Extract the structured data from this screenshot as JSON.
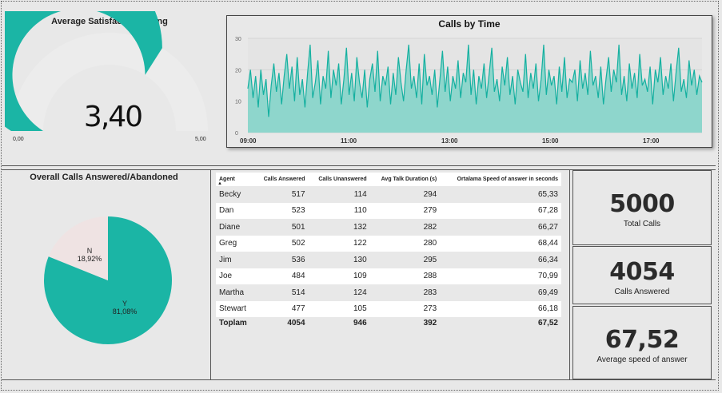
{
  "satisfaction": {
    "title": "Average Satisfaction Rating",
    "value_label": "3,40",
    "value": 3.4,
    "min_label": "0,00",
    "max_label": "5,00",
    "min": 0,
    "max": 5,
    "fill_color": "#1bb5a5",
    "track_color": "#ececec"
  },
  "chart_data": {
    "type": "area",
    "title": "Calls by Time",
    "xlabel": "",
    "ylabel": "",
    "ylim": [
      0,
      30
    ],
    "yticks": [
      "0",
      "10",
      "20",
      "30"
    ],
    "xticks": [
      "09:00",
      "11:00",
      "13:00",
      "15:00",
      "17:00"
    ],
    "grid": true,
    "line_color": "#14b0a0",
    "fill_color": "#8ed6cc",
    "values": [
      14,
      20,
      11,
      18,
      8,
      20,
      12,
      17,
      5,
      15,
      22,
      13,
      19,
      9,
      18,
      25,
      14,
      21,
      10,
      24,
      12,
      17,
      8,
      19,
      28,
      11,
      16,
      23,
      9,
      18,
      14,
      26,
      11,
      20,
      15,
      22,
      9,
      17,
      27,
      12,
      19,
      10,
      24,
      16,
      11,
      20,
      8,
      17,
      22,
      13,
      26,
      10,
      18,
      15,
      21,
      9,
      19,
      12,
      24,
      16,
      10,
      20,
      28,
      14,
      18,
      11,
      22,
      9,
      25,
      15,
      18,
      12,
      20,
      8,
      17,
      26,
      13,
      21,
      10,
      18,
      14,
      23,
      11,
      19,
      16,
      28,
      12,
      20,
      9,
      18,
      14,
      22,
      11,
      19,
      27,
      13,
      17,
      10,
      21,
      15,
      24,
      12,
      18,
      9,
      20,
      16,
      13,
      25,
      11,
      19,
      14,
      22,
      10,
      17,
      28,
      12,
      20,
      15,
      18,
      9,
      21,
      13,
      24,
      11,
      17,
      16,
      20,
      10,
      23,
      14,
      19,
      12,
      26,
      15,
      18,
      11,
      21,
      9,
      17,
      24,
      13,
      20,
      16,
      28,
      12,
      18,
      10,
      22,
      14,
      19,
      11,
      25,
      15,
      17,
      13,
      21,
      9,
      20,
      16,
      24,
      12,
      18,
      14,
      22,
      10,
      19,
      27,
      13,
      17,
      11,
      23,
      15,
      20,
      12,
      18,
      16
    ],
    "y_axis_labels": [
      "30",
      "20",
      "10",
      "0"
    ]
  },
  "answered_pie": {
    "title": "Overall Calls Answered/Abandoned",
    "slices": [
      {
        "name": "Y",
        "percent_label": "81,08%",
        "value": 81.08,
        "color": "#1bb5a5"
      },
      {
        "name": "N",
        "percent_label": "18,92%",
        "value": 18.92,
        "color": "#efe3e3"
      }
    ]
  },
  "agent_table": {
    "columns": [
      "Agent",
      "Calls Answered",
      "Calls Unanswered",
      "Avg Talk Duration (s)",
      "Ortalama Speed of answer in seconds"
    ],
    "rows": [
      [
        "Becky",
        "517",
        "114",
        "294",
        "65,33"
      ],
      [
        "Dan",
        "523",
        "110",
        "279",
        "67,28"
      ],
      [
        "Diane",
        "501",
        "132",
        "282",
        "66,27"
      ],
      [
        "Greg",
        "502",
        "122",
        "280",
        "68,44"
      ],
      [
        "Jim",
        "536",
        "130",
        "295",
        "66,34"
      ],
      [
        "Joe",
        "484",
        "109",
        "288",
        "70,99"
      ],
      [
        "Martha",
        "514",
        "124",
        "283",
        "69,49"
      ],
      [
        "Stewart",
        "477",
        "105",
        "273",
        "66,18"
      ]
    ],
    "total": [
      "Toplam",
      "4054",
      "946",
      "392",
      "67,52"
    ]
  },
  "kpis": [
    {
      "value": "5000",
      "label": "Total Calls"
    },
    {
      "value": "4054",
      "label": "Calls Answered"
    },
    {
      "value": "67,52",
      "label": "Average speed of answer"
    }
  ]
}
